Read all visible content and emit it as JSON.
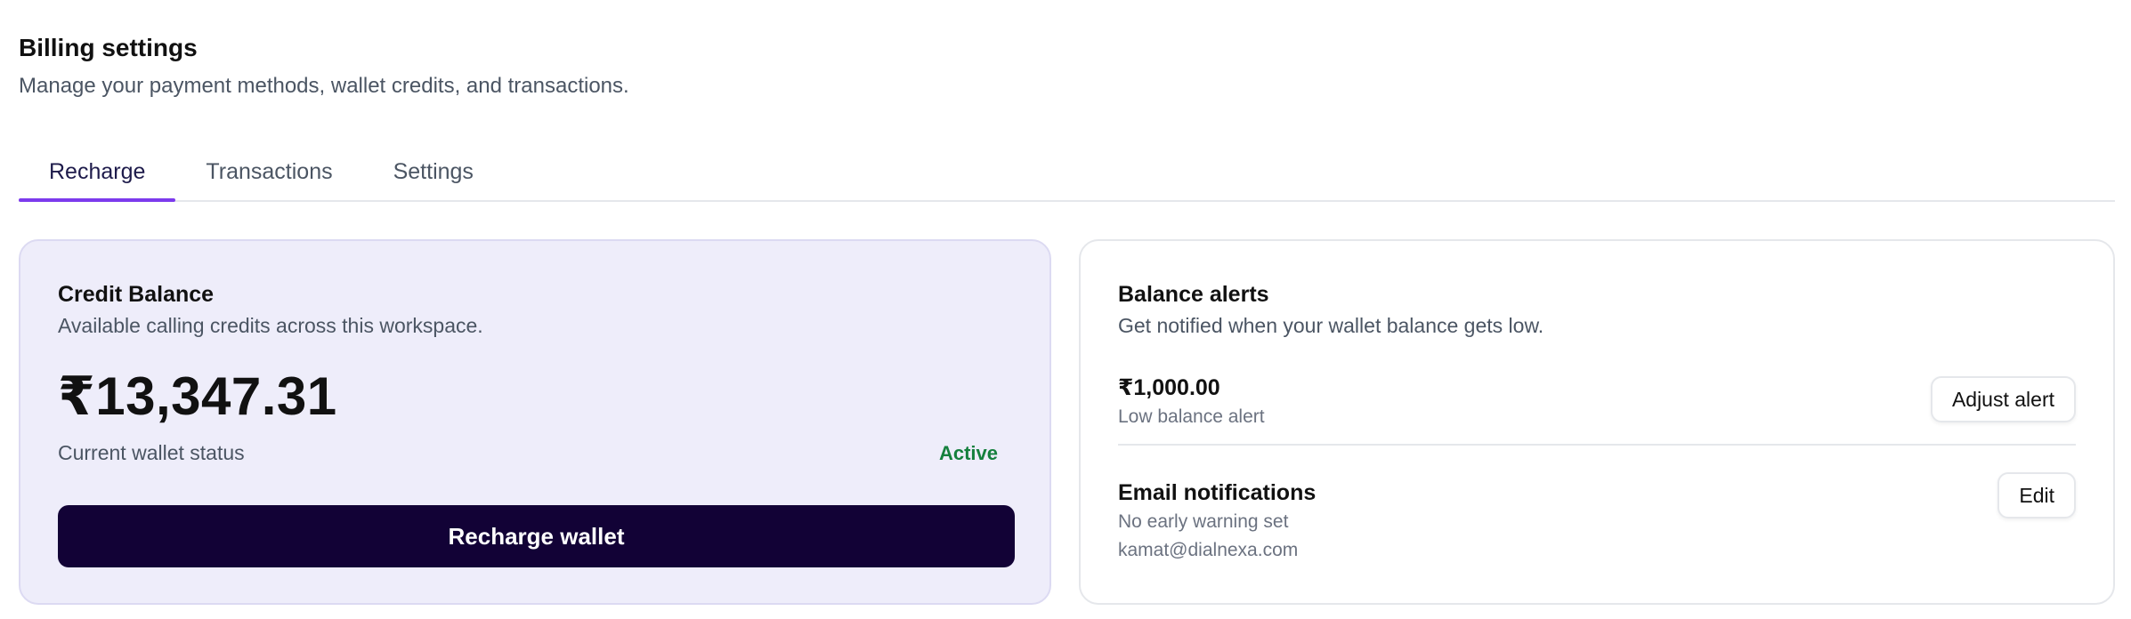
{
  "header": {
    "title": "Billing settings",
    "subtitle": "Manage your payment methods, wallet credits, and transactions."
  },
  "tabs": [
    {
      "label": "Recharge",
      "active": true
    },
    {
      "label": "Transactions",
      "active": false
    },
    {
      "label": "Settings",
      "active": false
    }
  ],
  "credit_card": {
    "title": "Credit Balance",
    "description": "Available calling credits across this workspace.",
    "balance": "₹13,347.31",
    "status_label": "Current wallet status",
    "status_value": "Active",
    "recharge_label": "Recharge wallet"
  },
  "alerts_card": {
    "title": "Balance alerts",
    "description": "Get notified when your wallet balance gets low.",
    "low_balance": {
      "amount": "₹1,000.00",
      "label": "Low balance alert",
      "button_label": "Adjust alert"
    },
    "email": {
      "title": "Email notifications",
      "warning": "No early warning set",
      "address": "kamat@dialnexa.com",
      "button_label": "Edit"
    }
  },
  "colors": {
    "accent": "#7c3aed",
    "primary_button": "#120236",
    "credit_card_bg": "#eeedfa",
    "status_active": "#15803d"
  }
}
